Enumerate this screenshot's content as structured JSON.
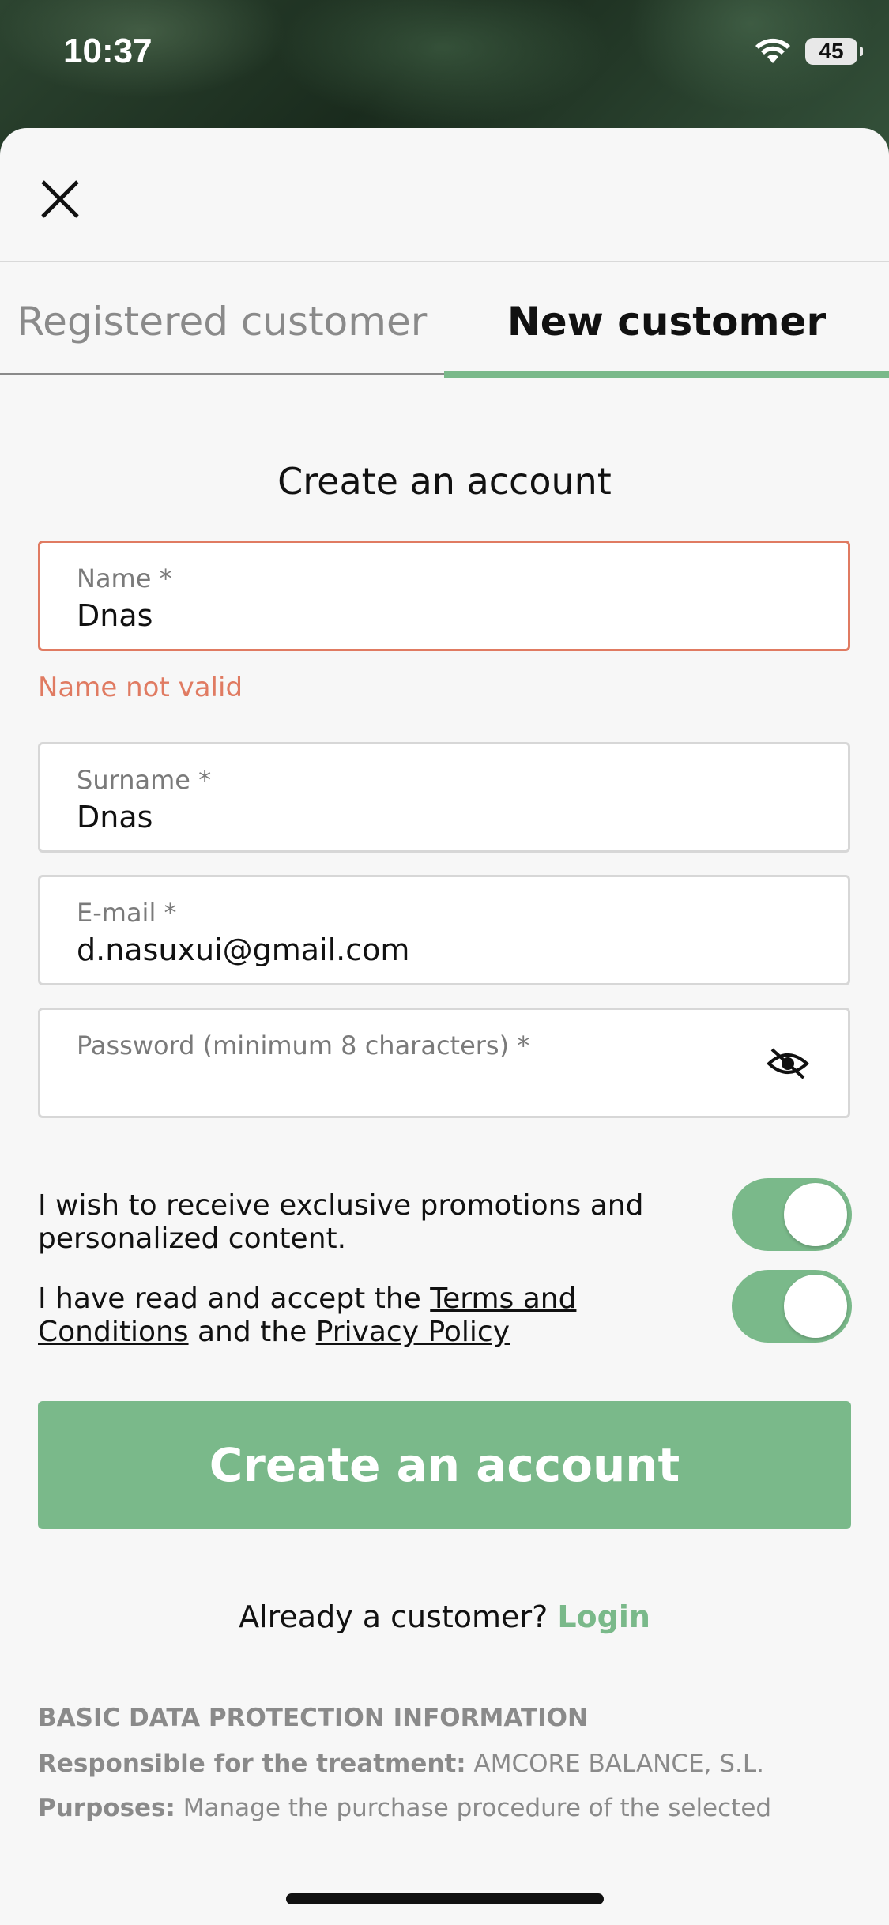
{
  "status_bar": {
    "time": "10:37",
    "battery": "45"
  },
  "tabs": [
    {
      "label": "Registered customer"
    },
    {
      "label": "New customer"
    }
  ],
  "form": {
    "title": "Create an account",
    "name": {
      "label": "Name *",
      "value": "Dnas",
      "error": "Name not valid"
    },
    "surname": {
      "label": "Surname *",
      "value": "Dnas"
    },
    "email": {
      "label": "E-mail *",
      "value": "d.nasuxui@gmail.com"
    },
    "password": {
      "label": "Password (minimum 8 characters) *",
      "value": ""
    }
  },
  "toggles": {
    "promotions": {
      "text": "I wish to receive exclusive promotions and personalized content.",
      "on": true
    },
    "terms": {
      "text_1": "I have read and accept the ",
      "terms_link": "Terms and Conditions",
      "text_2": " and the ",
      "privacy_link": "Privacy Policy",
      "on": true
    }
  },
  "create_button": "Create an account",
  "already": {
    "text": "Already a customer? ",
    "login": "Login"
  },
  "legal": {
    "heading": "BASIC DATA PROTECTION INFORMATION",
    "responsible_label": "Responsible for the treatment:",
    "responsible_value": "AMCORE BALANCE, S.L.",
    "purposes_label": "Purposes:",
    "purposes_value": "Manage the purchase procedure of the selected"
  },
  "colors": {
    "accent": "#7ab98a",
    "error": "#e07b62"
  }
}
